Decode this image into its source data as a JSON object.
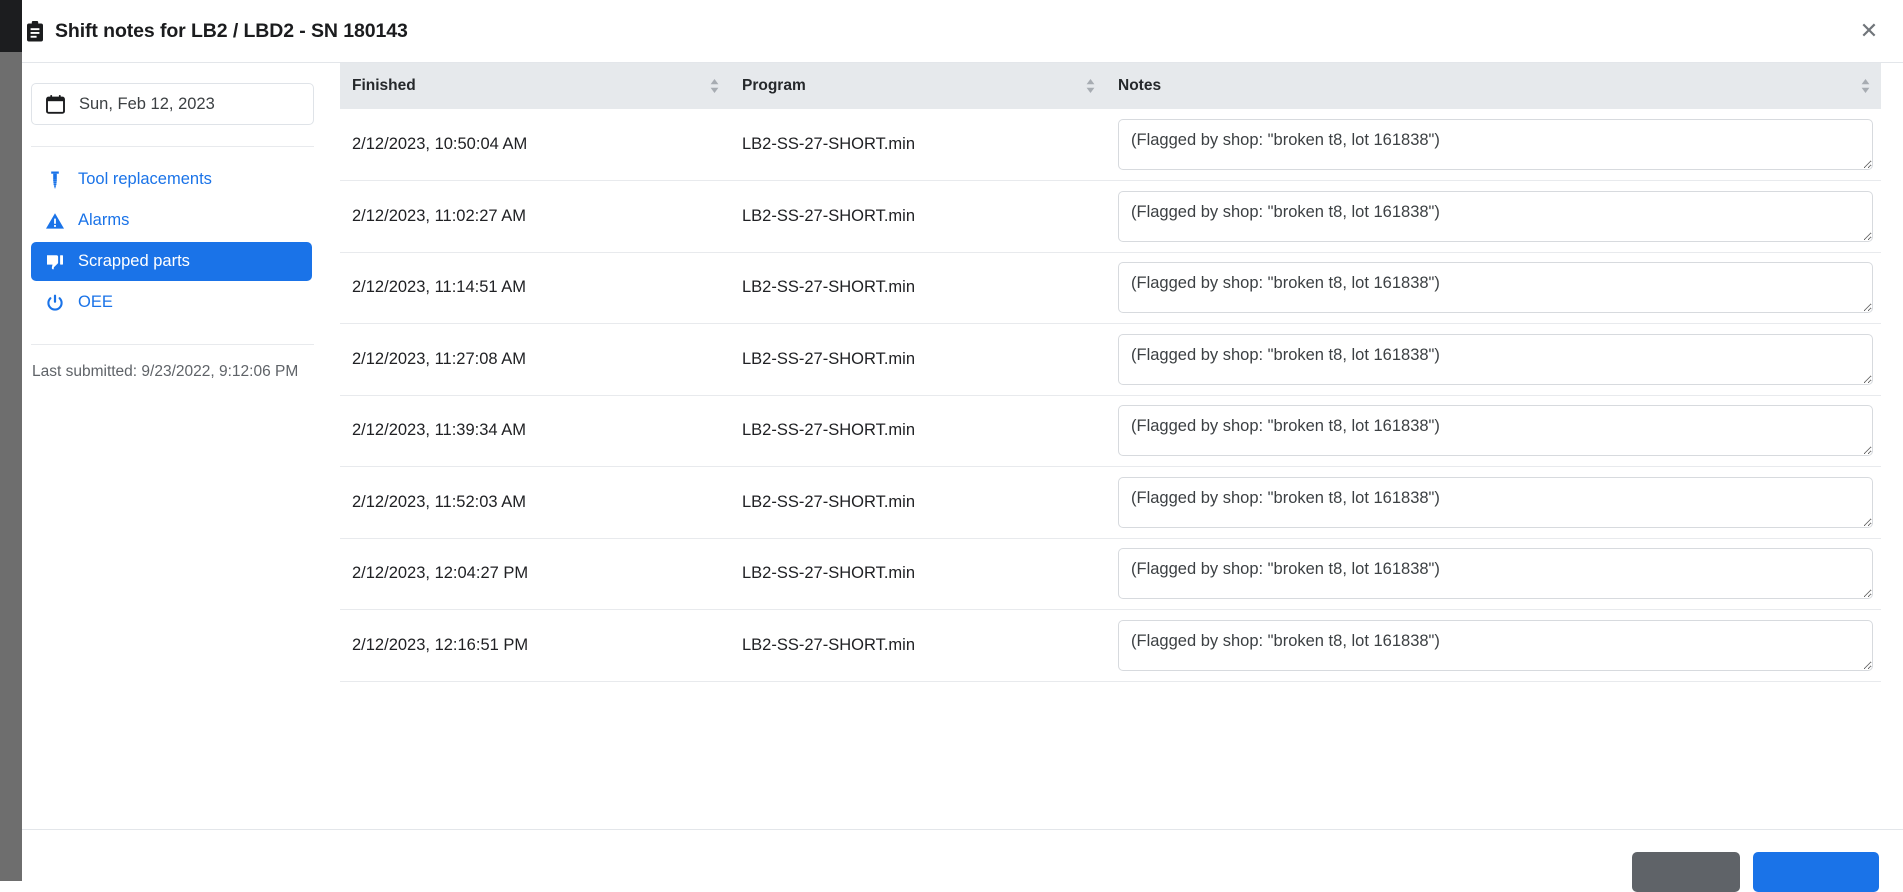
{
  "header": {
    "icon": "clipboard-icon",
    "title": "Shift notes for LB2 / LBD2 - SN 180143",
    "close_label": "✕"
  },
  "sidebar": {
    "date_picker": {
      "icon": "calendar-icon",
      "value": "Sun, Feb 12, 2023"
    },
    "nav_items": [
      {
        "label": "Tool replacements",
        "icon": "drill-bit-icon",
        "selected": false
      },
      {
        "label": "Alarms",
        "icon": "warning-triangle-icon",
        "selected": false
      },
      {
        "label": "Scrapped parts",
        "icon": "thumbs-down-icon",
        "selected": true
      },
      {
        "label": "OEE",
        "icon": "power-icon",
        "selected": false
      }
    ],
    "last_submitted": "Last submitted: 9/23/2022, 9:12:06 PM"
  },
  "table": {
    "columns": [
      {
        "label": "Finished",
        "sortable": true
      },
      {
        "label": "Program",
        "sortable": true
      },
      {
        "label": "Notes",
        "sortable": true
      }
    ],
    "rows": [
      {
        "finished": "2/12/2023, 10:50:04 AM",
        "program": "LB2-SS-27-SHORT.min",
        "note_placeholder": "(Flagged by shop: \"broken t8, lot 161838\")",
        "note_value": ""
      },
      {
        "finished": "2/12/2023, 11:02:27 AM",
        "program": "LB2-SS-27-SHORT.min",
        "note_placeholder": "(Flagged by shop: \"broken t8, lot 161838\")",
        "note_value": ""
      },
      {
        "finished": "2/12/2023, 11:14:51 AM",
        "program": "LB2-SS-27-SHORT.min",
        "note_placeholder": "(Flagged by shop: \"broken t8, lot 161838\")",
        "note_value": ""
      },
      {
        "finished": "2/12/2023, 11:27:08 AM",
        "program": "LB2-SS-27-SHORT.min",
        "note_placeholder": "(Flagged by shop: \"broken t8, lot 161838\")",
        "note_value": ""
      },
      {
        "finished": "2/12/2023, 11:39:34 AM",
        "program": "LB2-SS-27-SHORT.min",
        "note_placeholder": "(Flagged by shop: \"broken t8, lot 161838\")",
        "note_value": ""
      },
      {
        "finished": "2/12/2023, 11:52:03 AM",
        "program": "LB2-SS-27-SHORT.min",
        "note_placeholder": "(Flagged by shop: \"broken t8, lot 161838\")",
        "note_value": ""
      },
      {
        "finished": "2/12/2023, 12:04:27 PM",
        "program": "LB2-SS-27-SHORT.min",
        "note_placeholder": "(Flagged by shop: \"broken t8, lot 161838\")",
        "note_value": ""
      },
      {
        "finished": "2/12/2023, 12:16:51 PM",
        "program": "LB2-SS-27-SHORT.min",
        "note_placeholder": "(Flagged by shop: \"broken t8, lot 161838\")",
        "note_value": ""
      }
    ]
  },
  "footer": {
    "cancel_label": "",
    "submit_label": ""
  },
  "colors": {
    "accent_blue": "#1a73e8",
    "header_bg": "#e6e9ec",
    "cancel_gray": "#5f6368",
    "text_primary": "#202124",
    "text_muted": "#5f6368",
    "border": "#e8eaed"
  }
}
